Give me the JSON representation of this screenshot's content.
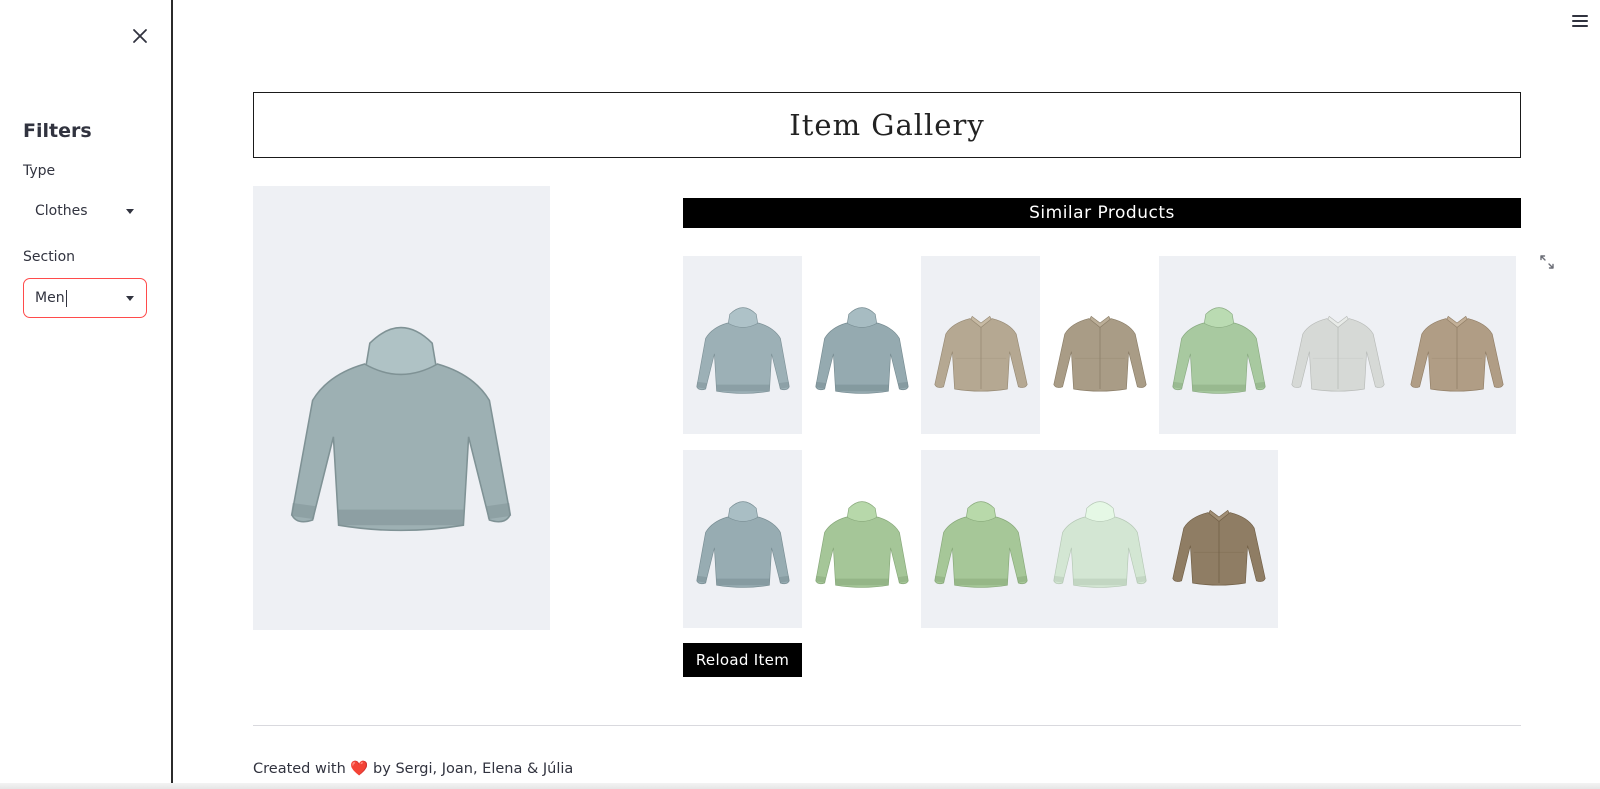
{
  "sidebar": {
    "title": "Filters",
    "type_label": "Type",
    "type_value": "Clothes",
    "section_label": "Section",
    "section_value": "Men"
  },
  "main": {
    "title": "Item Gallery",
    "similar_title": "Similar Products",
    "reload_label": "Reload Item"
  },
  "footer": {
    "prefix": "Created with",
    "heart": "❤️",
    "suffix": "by Sergi, Joan, Elena & Júlia"
  },
  "products": {
    "main": {
      "kind": "hoodie",
      "color": "#9db0b3"
    },
    "row1": [
      {
        "kind": "hoodie",
        "color": "#9cb0b6"
      },
      {
        "kind": "hoodie",
        "color": "#95aab0"
      },
      {
        "kind": "jacket",
        "color": "#b5a892"
      },
      {
        "kind": "jacket",
        "color": "#a99c86"
      },
      {
        "kind": "hoodie",
        "color": "#a8c9a0"
      },
      {
        "kind": "jacket",
        "color": "#d6d9d6"
      },
      {
        "kind": "jacket",
        "color": "#b09d85"
      }
    ],
    "row2": [
      {
        "kind": "hoodie",
        "color": "#97acb2"
      },
      {
        "kind": "hoodie",
        "color": "#a5c698"
      },
      {
        "kind": "hoodie",
        "color": "#a6c798"
      },
      {
        "kind": "hoodie",
        "color": "#d3e6d3"
      },
      {
        "kind": "jacket",
        "color": "#8f7d64"
      }
    ]
  },
  "icons": {
    "close": "close-icon",
    "menu": "hamburger-menu-icon",
    "expand": "expand-icon",
    "caret": "chevron-down-icon"
  },
  "colors": {
    "focus_border": "#ff4b4b",
    "header_bg": "#000000",
    "thumb_bg": "#eef0f4"
  }
}
